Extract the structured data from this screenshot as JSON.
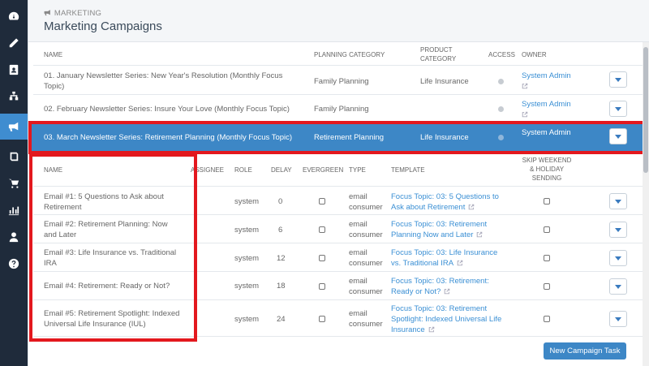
{
  "sidebar": {
    "items": [
      {
        "icon": "dashboard-icon"
      },
      {
        "icon": "pencil-icon"
      },
      {
        "icon": "contact-card-icon"
      },
      {
        "icon": "org-chart-icon"
      },
      {
        "icon": "megaphone-icon",
        "active": true
      },
      {
        "icon": "book-icon"
      },
      {
        "icon": "cart-icon"
      },
      {
        "icon": "bar-chart-icon"
      },
      {
        "icon": "user-icon"
      },
      {
        "icon": "help-icon"
      }
    ]
  },
  "header": {
    "breadcrumb": "MARKETING",
    "title": "Marketing Campaigns"
  },
  "campaigns": {
    "columns": {
      "name": "NAME",
      "planning": "PLANNING CATEGORY",
      "product_l1": "PRODUCT",
      "product_l2": "CATEGORY",
      "access": "ACCESS",
      "owner": "OWNER"
    },
    "rows": [
      {
        "name_l1": "01. January Newsletter Series: New Year's Resolution (Monthly Focus",
        "name_l2": "Topic)",
        "planning": "Family Planning",
        "product": "Life Insurance",
        "owner": "System Admin"
      },
      {
        "name_l1": "02. February Newsletter Series: Insure Your Love (Monthly Focus Topic)",
        "planning": "Family Planning",
        "product": "",
        "owner": "System Admin"
      },
      {
        "name_l1": "03. March Newsletter Series: Retirement Planning (Monthly Focus Topic)",
        "planning": "Retirement Planning",
        "product": "Life Insurance",
        "owner": "System Admin",
        "selected": true
      }
    ]
  },
  "tasks": {
    "columns": {
      "name": "NAME",
      "assignee": "ASSIGNEE",
      "role": "ROLE",
      "delay": "DELAY",
      "evergreen": "EVERGREEN",
      "type": "TYPE",
      "template": "TEMPLATE",
      "skip_l1": "SKIP WEEKEND",
      "skip_l2": "& HOLIDAY",
      "skip_l3": "SENDING"
    },
    "rows": [
      {
        "name_l1": "Email #1: 5 Questions to Ask about",
        "name_l2": "Retirement",
        "role": "system",
        "delay": "0",
        "type_l1": "email",
        "type_l2": "consumer",
        "tpl_l1": "Focus Topic: 03: 5 Questions to",
        "tpl_l2": "Ask about Retirement",
        "tpl_l3": ""
      },
      {
        "name_l1": "Email #2: Retirement Planning: Now",
        "name_l2": "and Later",
        "role": "system",
        "delay": "6",
        "type_l1": "email",
        "type_l2": "consumer",
        "tpl_l1": "Focus Topic: 03: Retirement",
        "tpl_l2": "Planning Now and Later",
        "tpl_l3": ""
      },
      {
        "name_l1": "Email #3: Life Insurance vs. Traditional",
        "name_l2": "IRA",
        "role": "system",
        "delay": "12",
        "type_l1": "email",
        "type_l2": "consumer",
        "tpl_l1": "Focus Topic: 03: Life Insurance",
        "tpl_l2": "vs. Traditional IRA",
        "tpl_l3": ""
      },
      {
        "name_l1": "Email #4: Retirement: Ready or Not?",
        "name_l2": "",
        "role": "system",
        "delay": "18",
        "type_l1": "email",
        "type_l2": "consumer",
        "tpl_l1": "Focus Topic: 03: Retirement:",
        "tpl_l2": "Ready or Not?",
        "tpl_l3": ""
      },
      {
        "name_l1": "Email #5: Retirement Spotlight: Indexed",
        "name_l2": "Universal Life Insurance (IUL)",
        "role": "system",
        "delay": "24",
        "type_l1": "email",
        "type_l2": "consumer",
        "tpl_l1": "Focus Topic: 03: Retirement",
        "tpl_l2": "Spotlight: Indexed Universal Life",
        "tpl_l3": "Insurance"
      }
    ]
  },
  "actions": {
    "new_task": "New Campaign Task"
  },
  "colors": {
    "sidebar_bg": "#1f2b3b",
    "accent": "#3d87c6",
    "highlight": "#e3181e",
    "link": "#3a8fd4"
  }
}
